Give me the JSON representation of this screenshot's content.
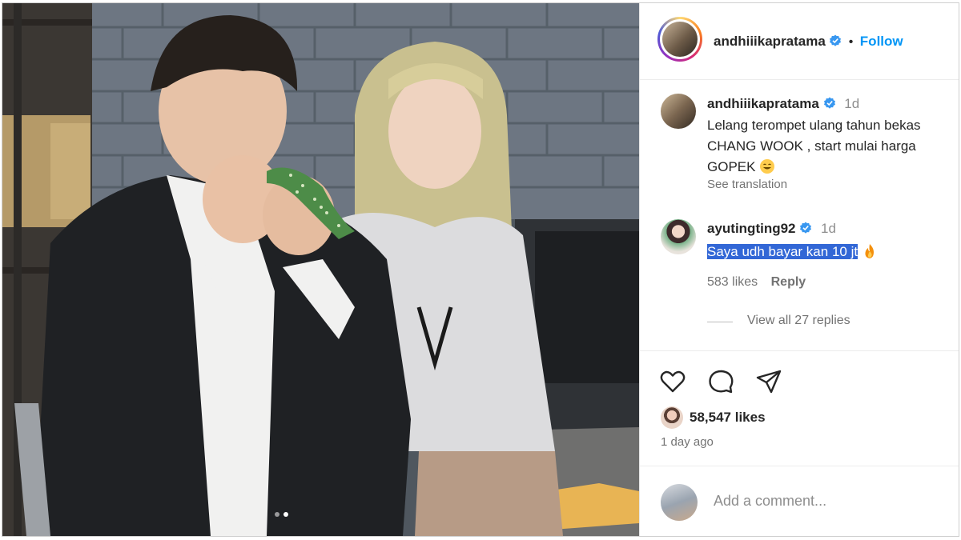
{
  "post": {
    "author": "andhiiikapratama",
    "follow_label": "Follow",
    "separator": "•",
    "photo_description_icon": "carousel-photo",
    "carousel": {
      "total": 2,
      "active": 2
    }
  },
  "caption": {
    "author": "andhiiikapratama",
    "time": "1d",
    "text": "Lelang terompet ulang tahun bekas CHANG WOOK , start mulai harga GOPEK",
    "see_translation": "See translation"
  },
  "comment": {
    "author": "ayutingting92",
    "time": "1d",
    "text": "Saya udh bayar kan 10 jt",
    "likes": "583 likes",
    "reply_label": "Reply",
    "view_replies": "View all 27 replies"
  },
  "actions": {
    "like_icon": "heart-icon",
    "comment_icon": "comment-icon",
    "share_icon": "paper-plane-icon"
  },
  "stats": {
    "likes": "58,547 likes",
    "date": "1 day ago"
  },
  "composer": {
    "placeholder": "Add a comment..."
  },
  "colors": {
    "accent": "#0095f6",
    "highlight": "#3267d6",
    "text": "#262626",
    "muted": "#737373"
  }
}
